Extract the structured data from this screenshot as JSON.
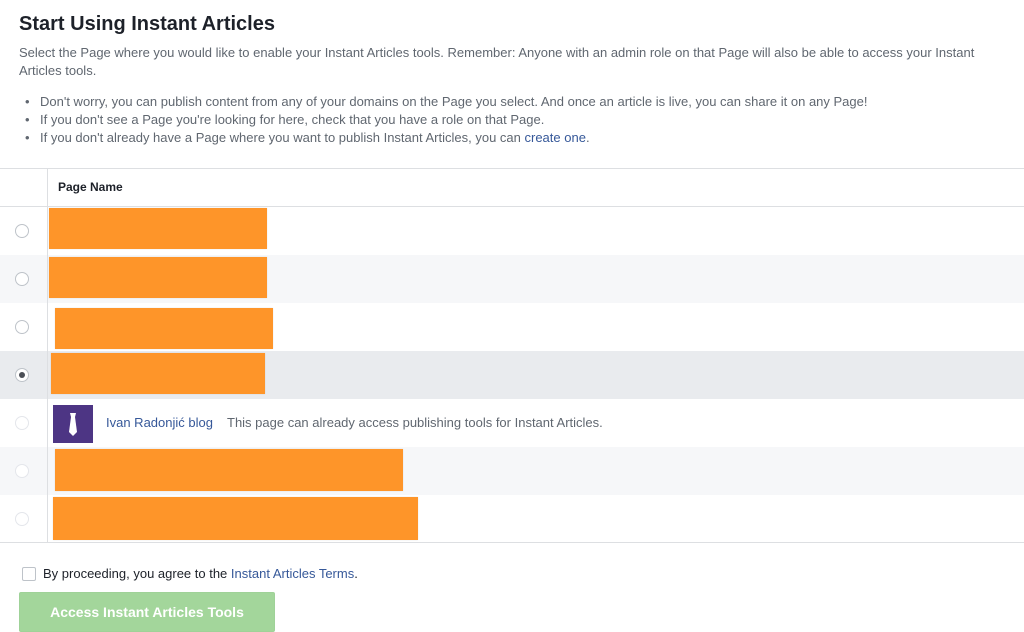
{
  "header": {
    "title": "Start Using Instant Articles",
    "description": "Select the Page where you would like to enable your Instant Articles tools. Remember: Anyone with an admin role on that Page will also be able to access your Instant Articles tools."
  },
  "bullets": [
    "Don't worry, you can publish content from any of your domains on the Page you select. And once an article is live, you can share it on any Page!",
    "If you don't see a Page you're looking for here, check that you have a role on that Page."
  ],
  "bullet_create": {
    "prefix": "If you don't already have a Page where you want to publish Instant Articles, you can ",
    "link": "create one",
    "suffix": "."
  },
  "table": {
    "column_header": "Page Name",
    "special_row": {
      "page_name": "Ivan Radonjić blog",
      "note": "This page can already access publishing tools for Instant Articles."
    }
  },
  "terms": {
    "prefix": "By proceeding, you agree to the ",
    "link": "Instant Articles Terms",
    "suffix": "."
  },
  "button": {
    "label": "Access Instant Articles Tools"
  },
  "colors": {
    "link": "#365899",
    "redaction": "#fe9529",
    "button_disabled": "#a3d69b",
    "avatar_bg": "#4d3584"
  }
}
